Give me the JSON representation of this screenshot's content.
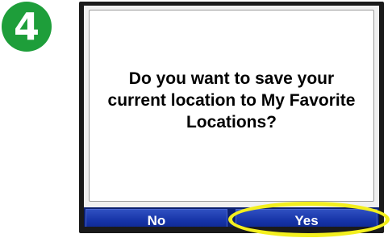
{
  "step": {
    "number": "4",
    "color": "#1e9e3a"
  },
  "dialog": {
    "message": "Do you want to save your current location to My Favorite Locations?"
  },
  "buttons": {
    "no_label": "No",
    "yes_label": "Yes",
    "bar_color": "#1533a6"
  },
  "highlight": {
    "target": "yes-button",
    "color": "#f3ef1e"
  }
}
